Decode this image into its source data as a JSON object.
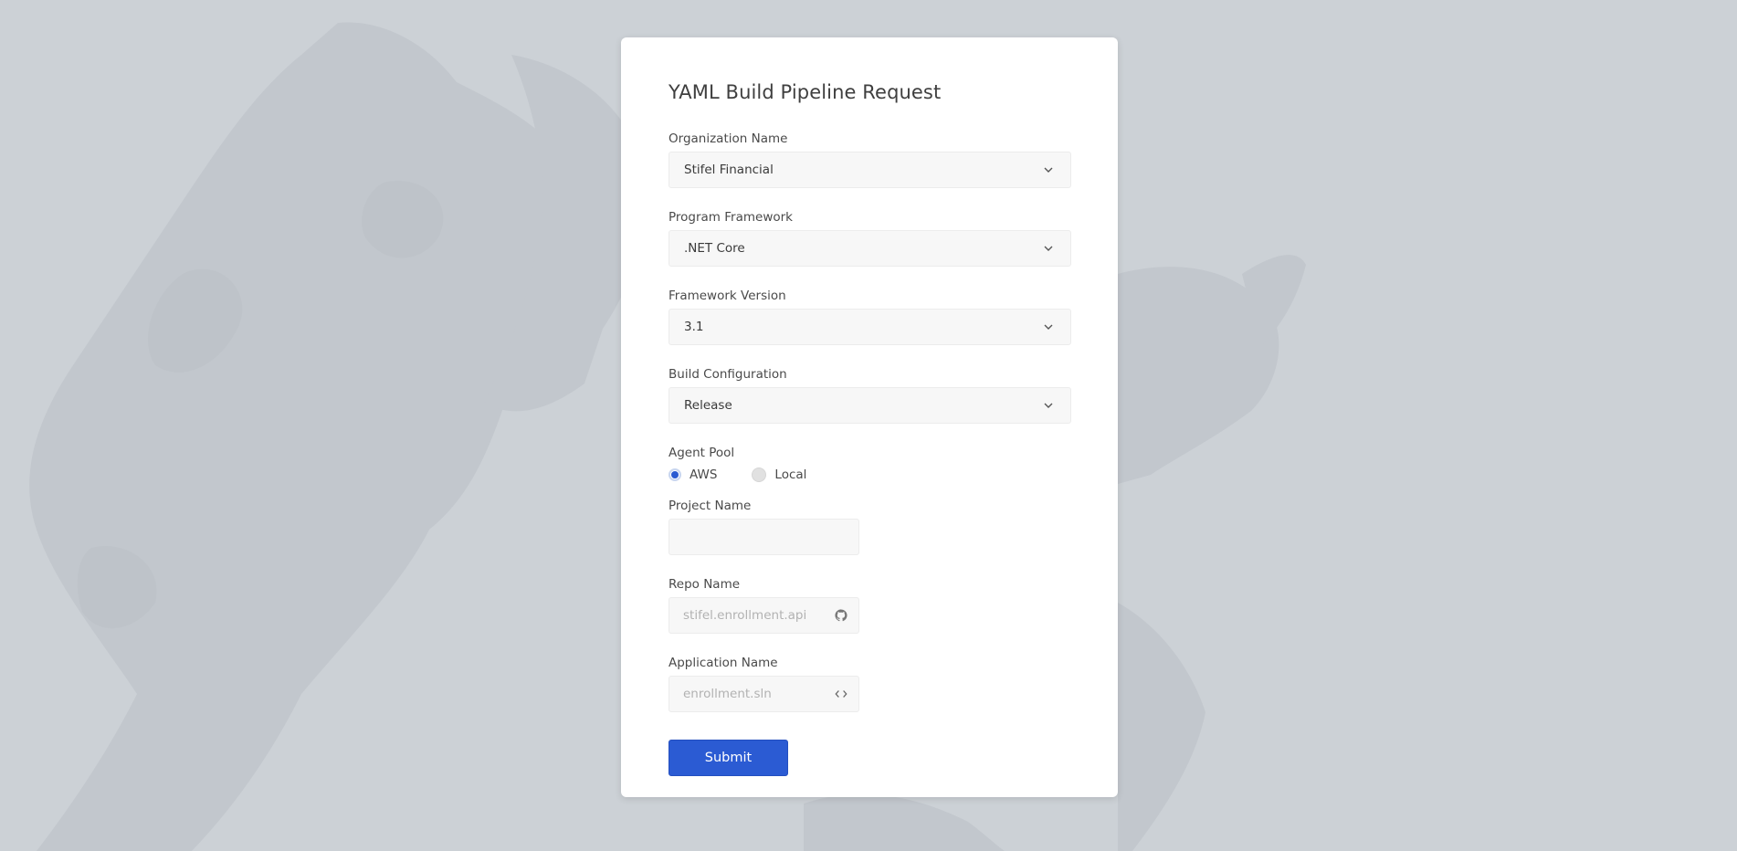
{
  "form": {
    "title": "YAML Build Pipeline Request",
    "organization": {
      "label": "Organization Name",
      "value": "Stifel Financial"
    },
    "framework": {
      "label": "Program Framework",
      "value": ".NET Core"
    },
    "version": {
      "label": "Framework Version",
      "value": "3.1"
    },
    "build_config": {
      "label": "Build Configuration",
      "value": "Release"
    },
    "agent_pool": {
      "label": "Agent Pool",
      "options": [
        {
          "label": "AWS",
          "selected": true
        },
        {
          "label": "Local",
          "selected": false
        }
      ]
    },
    "project_name": {
      "label": "Project Name",
      "value": ""
    },
    "repo_name": {
      "label": "Repo Name",
      "placeholder": "stifel.enrollment.api",
      "icon": "github-icon"
    },
    "app_name": {
      "label": "Application Name",
      "placeholder": "enrollment.sln",
      "icon": "code-icon"
    },
    "submit_label": "Submit"
  },
  "colors": {
    "page_bg": "#ccd1d6",
    "card_bg": "#ffffff",
    "accent": "#2b5bd3",
    "field_bg": "#f7f7f7"
  }
}
